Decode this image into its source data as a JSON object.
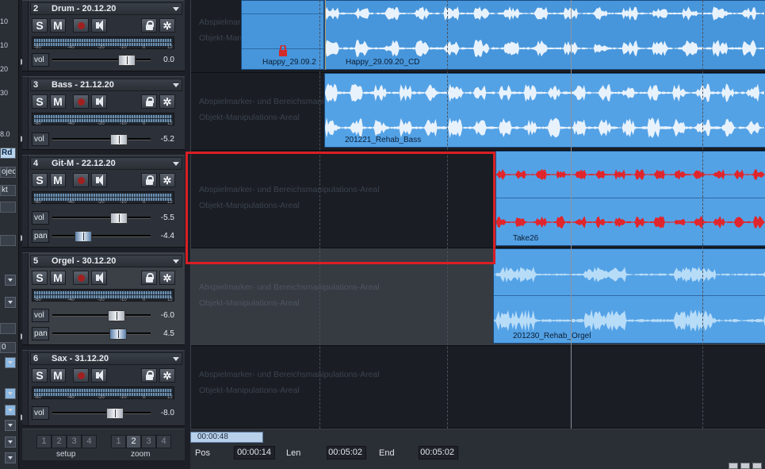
{
  "left_edge": {
    "numbers": [
      "10",
      "10",
      "20",
      "30",
      "8.0"
    ],
    "boxes": [
      "Rd",
      "oject",
      "kt",
      "0"
    ]
  },
  "tracks": [
    {
      "num": "2",
      "name": "Drum - 20.12.20",
      "vol": "0.0"
    },
    {
      "num": "3",
      "name": "Bass - 21.12.20",
      "vol": "-5.2"
    },
    {
      "num": "4",
      "name": "Git-M - 22.12.20",
      "vol": "-5.5",
      "pan": "-4.4"
    },
    {
      "num": "5",
      "name": "Orgel - 30.12.20",
      "vol": "-6.0",
      "pan": "4.5"
    },
    {
      "num": "6",
      "name": "Sax - 31.12.20",
      "vol": "-8.0"
    }
  ],
  "controls": {
    "solo": "S",
    "mute": "M",
    "vol_label": "vol",
    "pan_label": "pan",
    "meter_scale": [
      "-80",
      "-40",
      "-20",
      "-10",
      "0",
      "12"
    ]
  },
  "bottom_groups": {
    "setup": {
      "label": "setup",
      "buttons": [
        "1",
        "2",
        "3",
        "4"
      ],
      "active": "none"
    },
    "zoom": {
      "label": "zoom",
      "buttons": [
        "1",
        "2",
        "3",
        "4"
      ],
      "active": "2"
    }
  },
  "lane_markers": {
    "line1": "Abspielmarker- und Bereichsmanipulations-Areal",
    "line2": "Objekt-Manipulations-Areal"
  },
  "clips": [
    {
      "name": "Happy_29.09.2"
    },
    {
      "name": "Happy_29.09.20_CD"
    },
    {
      "name": "201221_Rehab_Bass"
    },
    {
      "name": "Take26"
    },
    {
      "name": "201230_Rehab_Orgel"
    }
  ],
  "status": {
    "scroll_time": "00:00:48",
    "pos_label": "Pos",
    "pos_value": "00:00:14",
    "len_label": "Len",
    "len_value": "00:05:02",
    "end_label": "End",
    "end_value": "00:05:02"
  },
  "colors": {
    "clip_blue": "#54a2e6",
    "wave_white": "#e8f2fc",
    "wave_red": "#e0262c",
    "highlight_red": "#d91f25"
  },
  "icons": {
    "record": "record-icon",
    "speaker": "speaker-icon",
    "lock": "lock-icon",
    "settings": "gear-icon",
    "menu": "dropdown-icon"
  }
}
